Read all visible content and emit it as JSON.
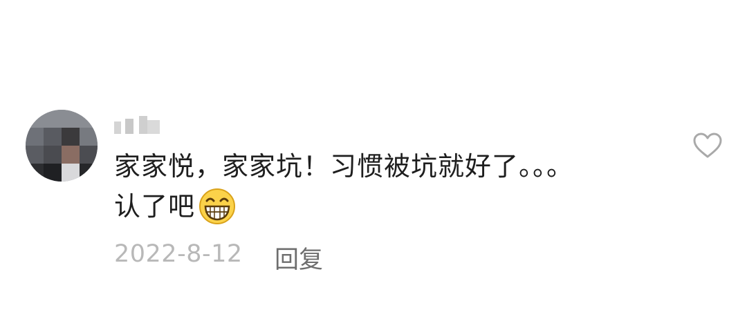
{
  "comment": {
    "avatar_icon": "avatar-pixelated-icon",
    "username_icon": "blurred-username-icon",
    "text_line1": "家家悦，家家坑！习惯被坑就好了。。。",
    "text_line2": "认了吧",
    "emoji_icon": "grinning-face-icon",
    "date": "2022-8-12",
    "reply_label": "回复",
    "like_icon": "heart-outline-icon"
  },
  "colors": {
    "text": "#1e1e1e",
    "date": "#b8b8b8",
    "reply": "#6e6e6e",
    "heart": "#a9a9a9",
    "emoji_face": "#fbd24a"
  }
}
